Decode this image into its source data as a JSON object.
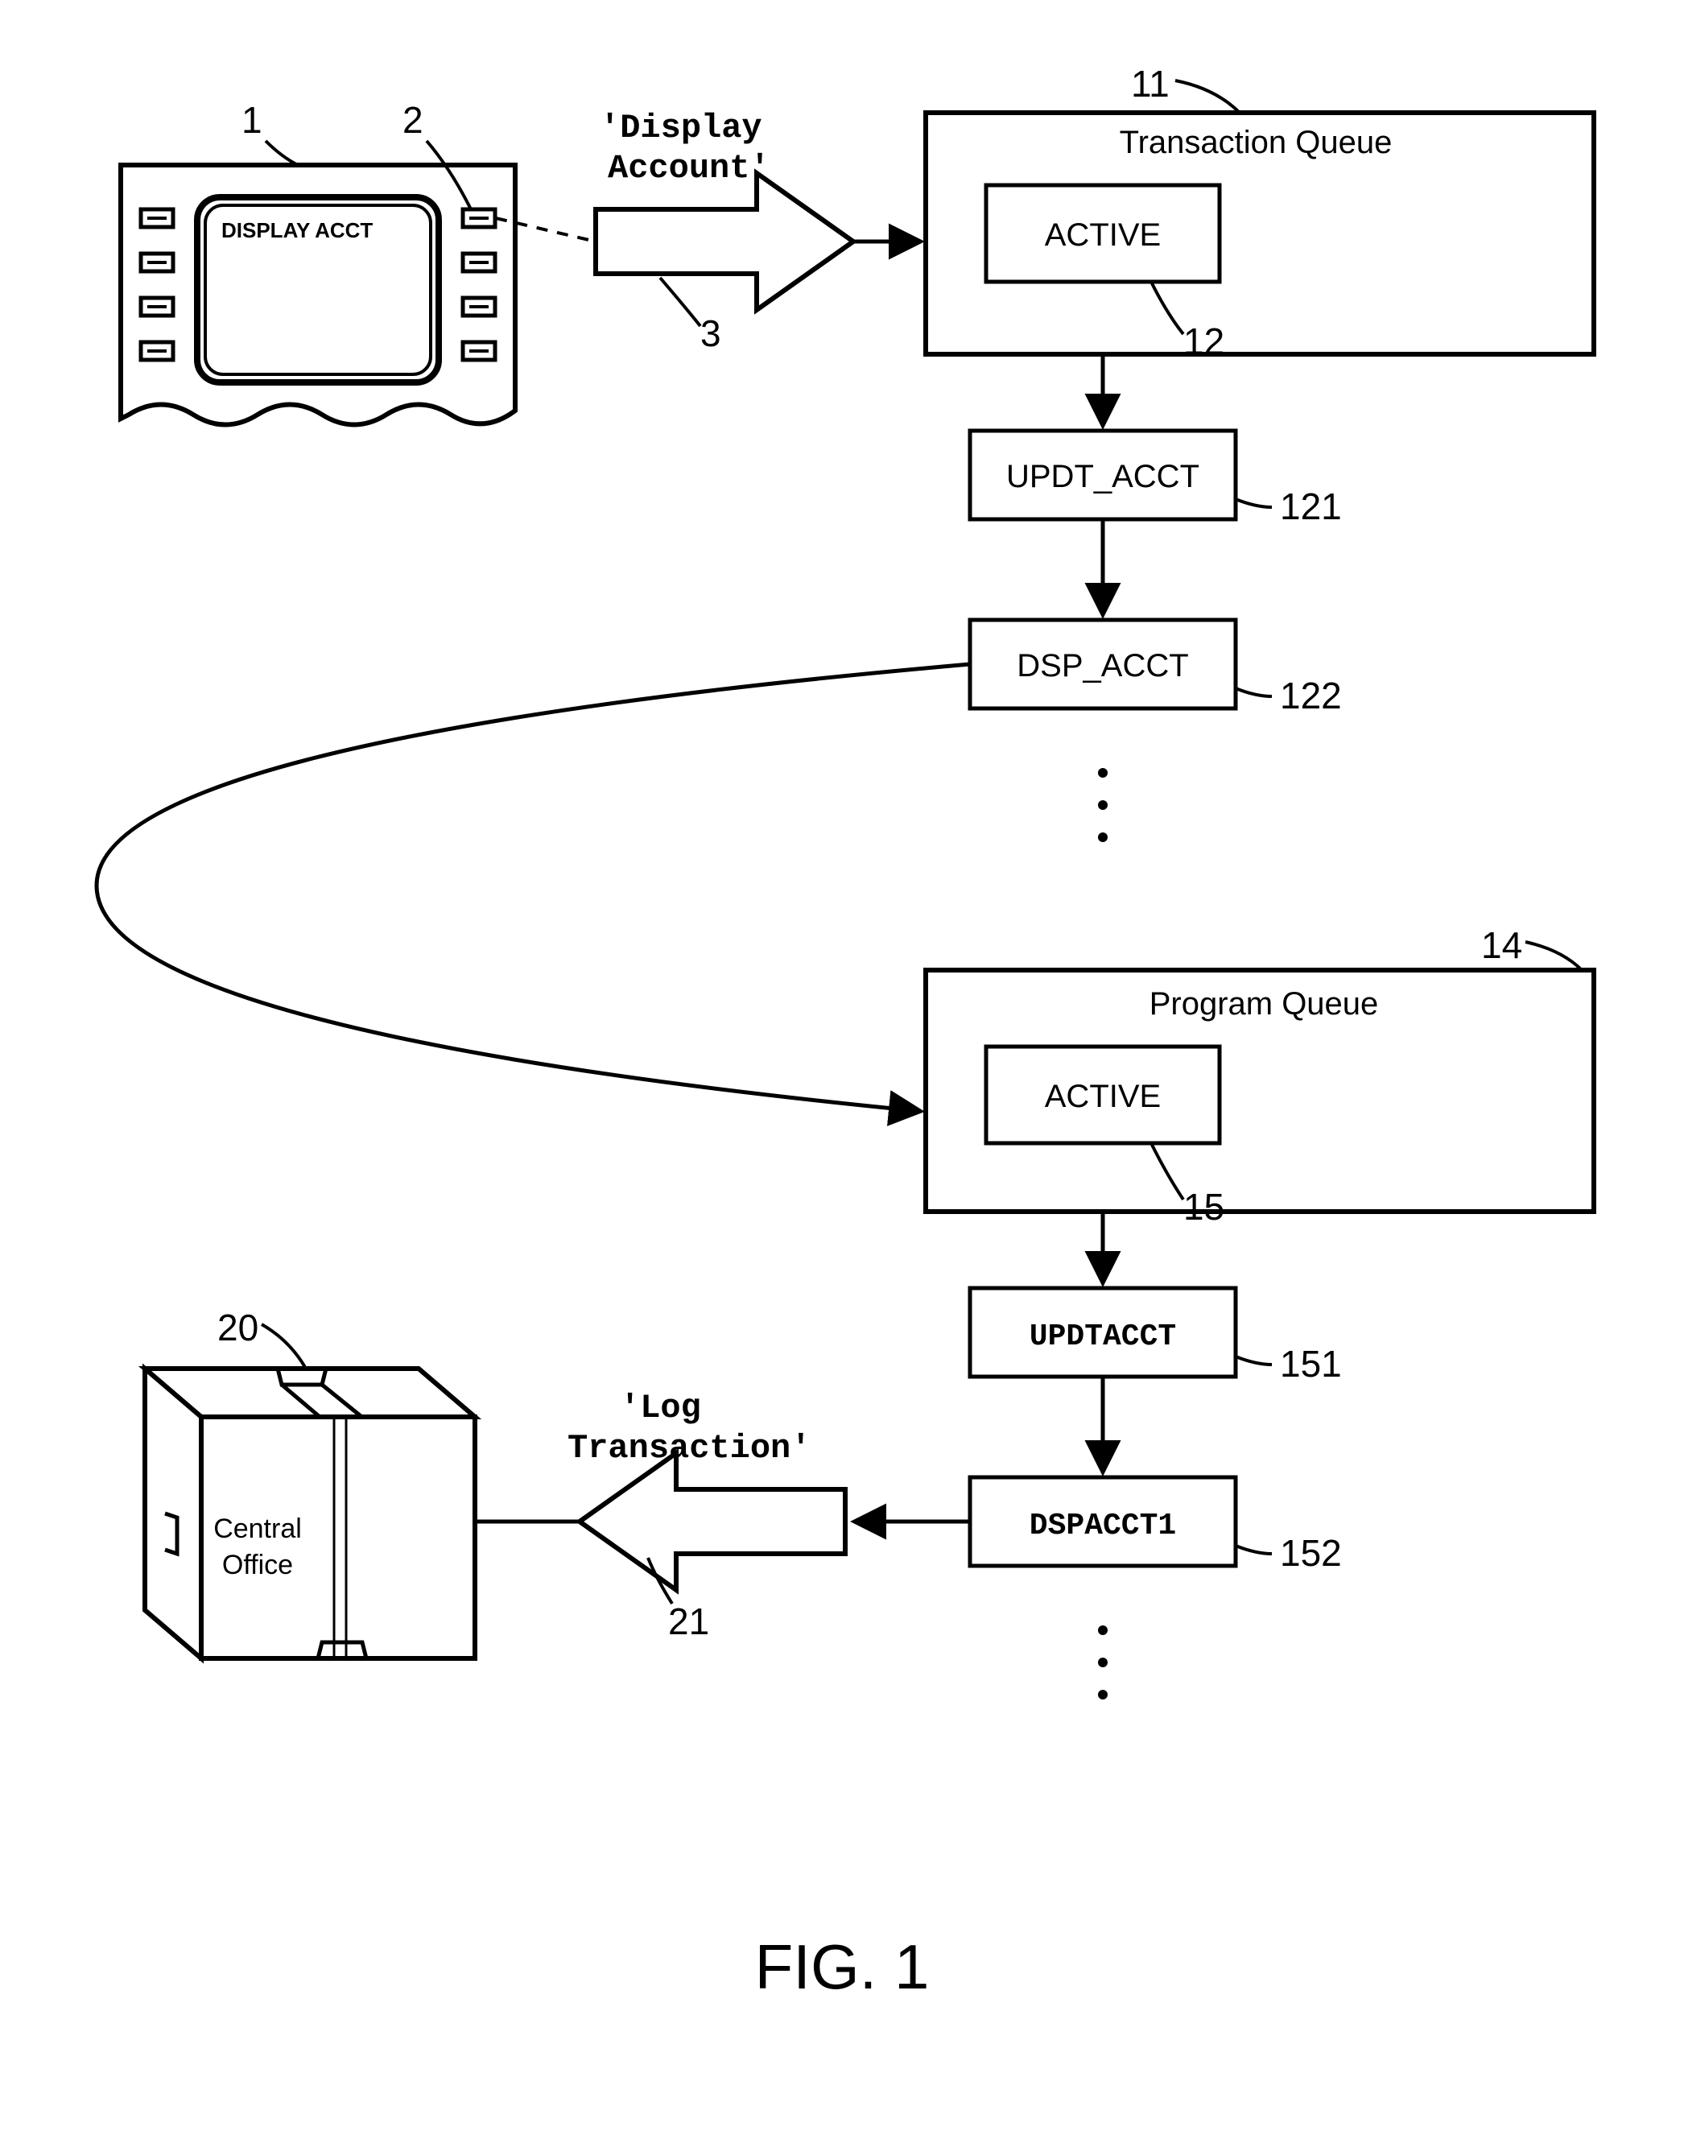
{
  "refs": {
    "r1": "1",
    "r2": "2",
    "r3": "3",
    "r11": "11",
    "r12": "12",
    "r121": "121",
    "r122": "122",
    "r14": "14",
    "r15": "15",
    "r151": "151",
    "r152": "152",
    "r20": "20",
    "r21": "21"
  },
  "terminal": {
    "screen_text": "DISPLAY ACCT"
  },
  "arrows": {
    "display_account_l1": "'Display",
    "display_account_l2": "Account'",
    "log_transaction_l1": "'Log",
    "log_transaction_l2": "Transaction'"
  },
  "transaction_queue": {
    "title": "Transaction Queue",
    "active": "ACTIVE",
    "item1": "UPDT_ACCT",
    "item2": "DSP_ACCT"
  },
  "program_queue": {
    "title": "Program Queue",
    "active": "ACTIVE",
    "item1": "UPDTACCT",
    "item2": "DSPACCT1"
  },
  "central_office_l1": "Central",
  "central_office_l2": "Office",
  "figure": "FIG. 1"
}
